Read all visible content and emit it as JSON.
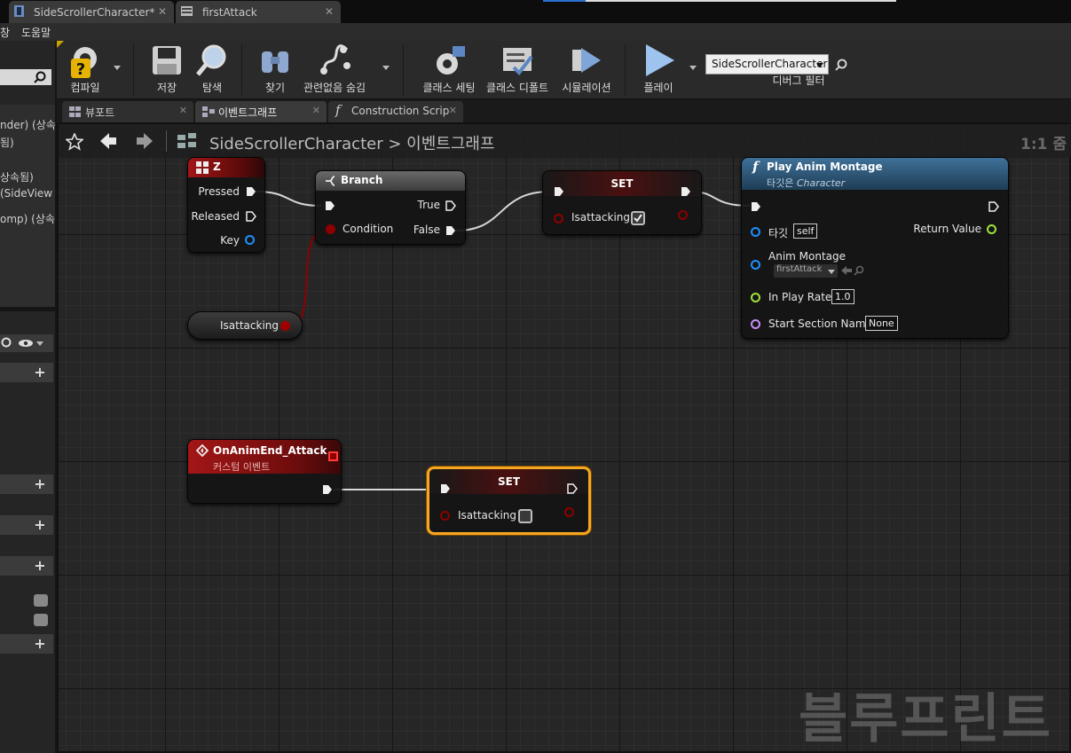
{
  "doc_tabs": [
    {
      "label": "SideScrollerCharacter*"
    },
    {
      "label": "firstAttack"
    }
  ],
  "menu": {
    "items": [
      "창",
      "도움말"
    ]
  },
  "left_panel": {
    "rows": [
      "nder) (상속",
      "됨)",
      "상속됨)",
      "(SideView",
      "omp) (상속"
    ]
  },
  "toolbar": {
    "compile": "컴파일",
    "save": "저장",
    "browse": "탐색",
    "find": "찾기",
    "hide_unrelated": "관련없음 숨김",
    "class_settings": "클래스 세팅",
    "class_defaults": "클래스 디폴트",
    "simulation": "시뮬레이션",
    "play": "플레이",
    "debug_object": "SideScrollerCharacter",
    "debug_filter": "디버그 필터"
  },
  "editor_tabs": [
    "뷰포트",
    "이벤트그래프",
    "Construction Scrip"
  ],
  "breadcrumb": {
    "root": "SideScrollerCharacter",
    "separator": ">",
    "current": "이벤트그래프"
  },
  "zoom": "1:1 줌",
  "watermark": "블루프린트",
  "nodes": {
    "z_event": {
      "title": "Z",
      "pressed": "Pressed",
      "released": "Released",
      "key": "Key"
    },
    "branch": {
      "title": "Branch",
      "condition": "Condition",
      "true": "True",
      "false": "False"
    },
    "set1": {
      "title": "SET",
      "var": "Isattacking",
      "value": true
    },
    "play_anim": {
      "title": "Play Anim Montage",
      "subtitle_prefix": "타깃은",
      "subtitle_target": "Character",
      "target_label": "타깃",
      "target_value": "self",
      "anim_label": "Anim Montage",
      "anim_value": "firstAttack",
      "rate_label": "In Play Rate",
      "rate_value": "1.0",
      "section_label": "Start Section Name",
      "section_value": "None",
      "return_label": "Return Value"
    },
    "get_isattacking": {
      "label": "Isattacking"
    },
    "custom_event": {
      "title": "OnAnimEnd_Attack",
      "subtitle": "커스텀 이벤트"
    },
    "set2": {
      "title": "SET",
      "var": "Isattacking",
      "value": false
    }
  },
  "colors": {
    "exec_wire": "#d8d8d8",
    "bool_pin": "#8e0000",
    "object_pin": "#1e90ff",
    "float_pin": "#9ee33a",
    "name_pin": "#c78ef5",
    "event_header": "#8b0f0f",
    "function_header": "#2f5f83",
    "selection": "#f5a623"
  }
}
